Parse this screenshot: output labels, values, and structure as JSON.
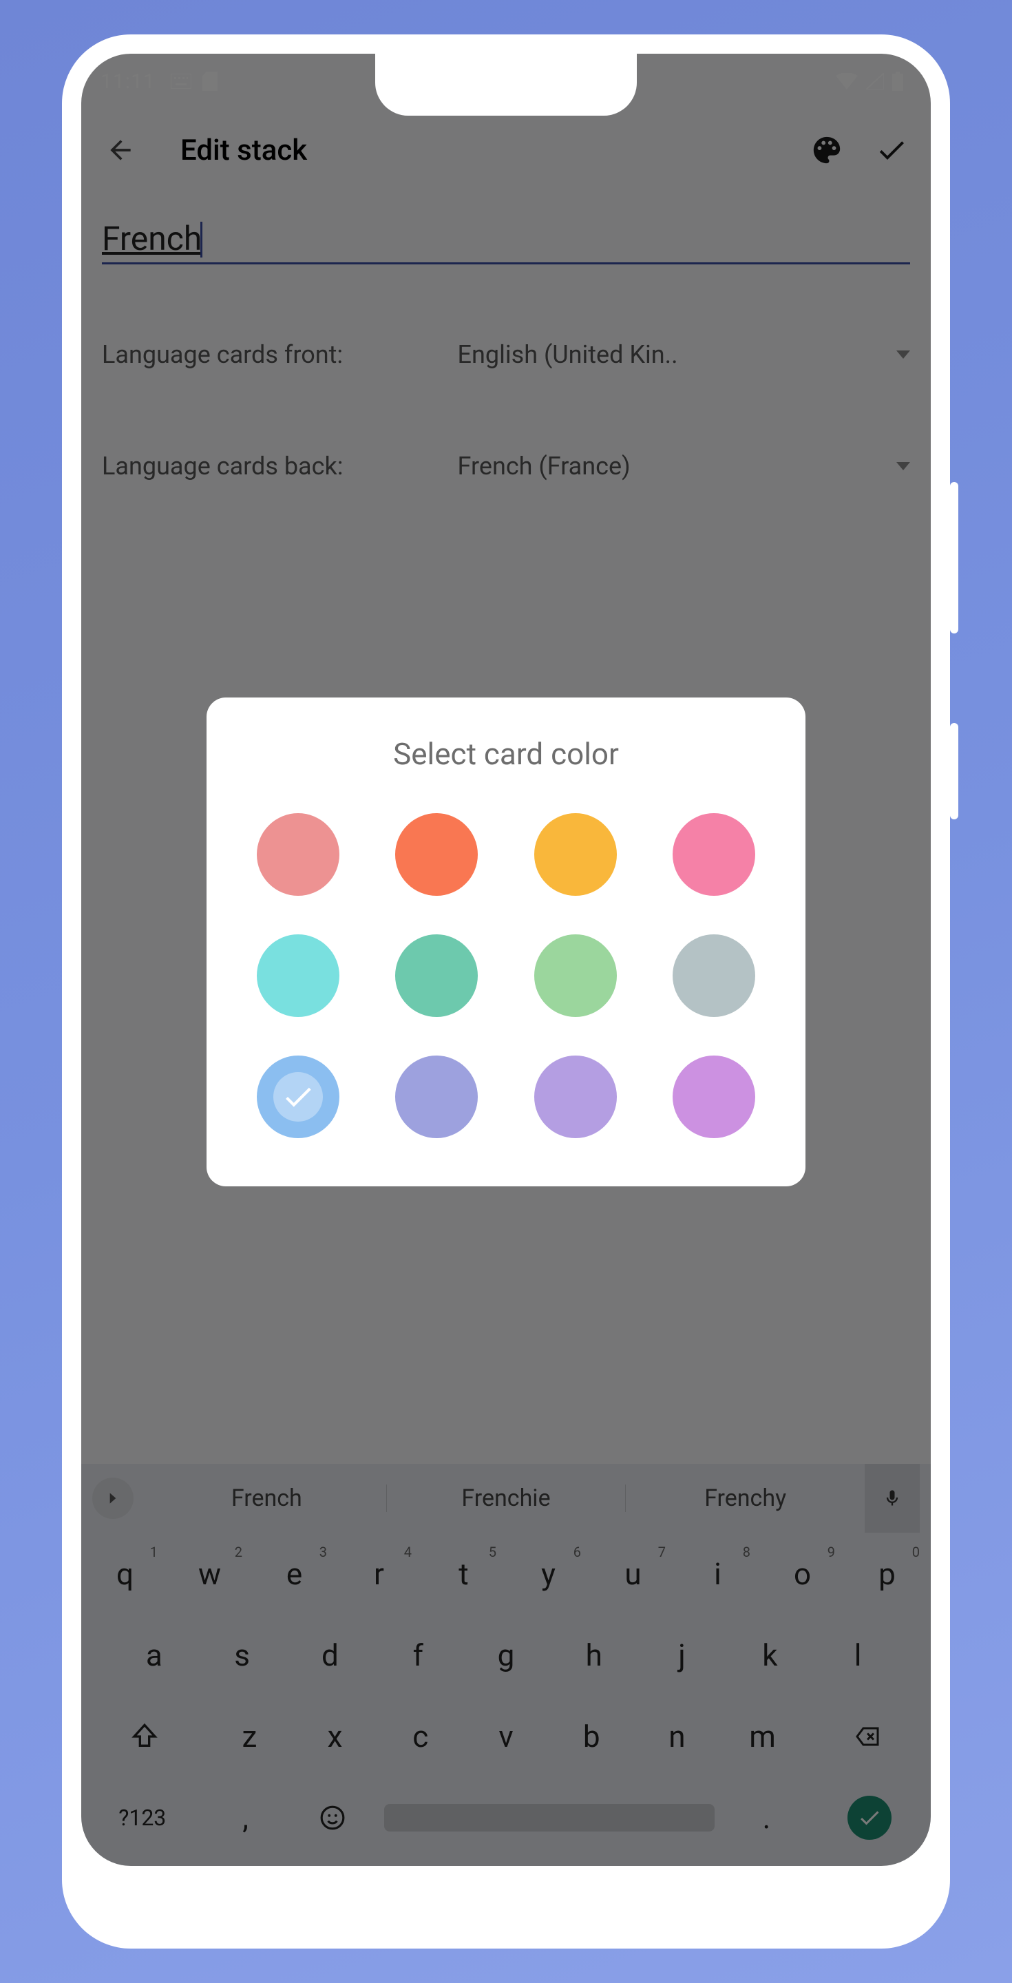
{
  "status_bar": {
    "time": "11:11",
    "icons_left": [
      "keyboard",
      "sd-card"
    ],
    "icons_right": [
      "wifi",
      "cell-signal",
      "battery"
    ]
  },
  "app_bar": {
    "title": "Edit stack",
    "back_icon": "arrow-back",
    "palette_icon": "palette",
    "confirm_icon": "check"
  },
  "form": {
    "stack_name_value": "French",
    "lang_front_label": "Language cards front:",
    "lang_front_value": "English (United Kin..",
    "lang_back_label": "Language cards back:",
    "lang_back_value": "French (France)"
  },
  "dialog": {
    "title": "Select card color",
    "colors": [
      {
        "name": "salmon",
        "hex": "#ed9292",
        "selected": false
      },
      {
        "name": "coral",
        "hex": "#f97752",
        "selected": false
      },
      {
        "name": "amber",
        "hex": "#f9b73b",
        "selected": false
      },
      {
        "name": "pink",
        "hex": "#f581a7",
        "selected": false
      },
      {
        "name": "cyan",
        "hex": "#79e0df",
        "selected": false
      },
      {
        "name": "teal",
        "hex": "#6dc9ad",
        "selected": false
      },
      {
        "name": "mint",
        "hex": "#9bd69d",
        "selected": false
      },
      {
        "name": "slate",
        "hex": "#b4c2c5",
        "selected": false
      },
      {
        "name": "sky-blue",
        "hex": "#8bbef0",
        "selected": true
      },
      {
        "name": "periwinkle",
        "hex": "#9da1de",
        "selected": false
      },
      {
        "name": "lavender",
        "hex": "#b49ee2",
        "selected": false
      },
      {
        "name": "orchid",
        "hex": "#cc91e1",
        "selected": false
      }
    ]
  },
  "keyboard": {
    "suggestions": [
      "French",
      "Frenchie",
      "Frenchy"
    ],
    "row1": [
      {
        "k": "q",
        "sup": "1"
      },
      {
        "k": "w",
        "sup": "2"
      },
      {
        "k": "e",
        "sup": "3"
      },
      {
        "k": "r",
        "sup": "4"
      },
      {
        "k": "t",
        "sup": "5"
      },
      {
        "k": "y",
        "sup": "6"
      },
      {
        "k": "u",
        "sup": "7"
      },
      {
        "k": "i",
        "sup": "8"
      },
      {
        "k": "o",
        "sup": "9"
      },
      {
        "k": "p",
        "sup": "0"
      }
    ],
    "row2": [
      "a",
      "s",
      "d",
      "f",
      "g",
      "h",
      "j",
      "k",
      "l"
    ],
    "row3": [
      "z",
      "x",
      "c",
      "v",
      "b",
      "n",
      "m"
    ],
    "symbols_key": "?123",
    "comma_key": ",",
    "period_key": "."
  }
}
